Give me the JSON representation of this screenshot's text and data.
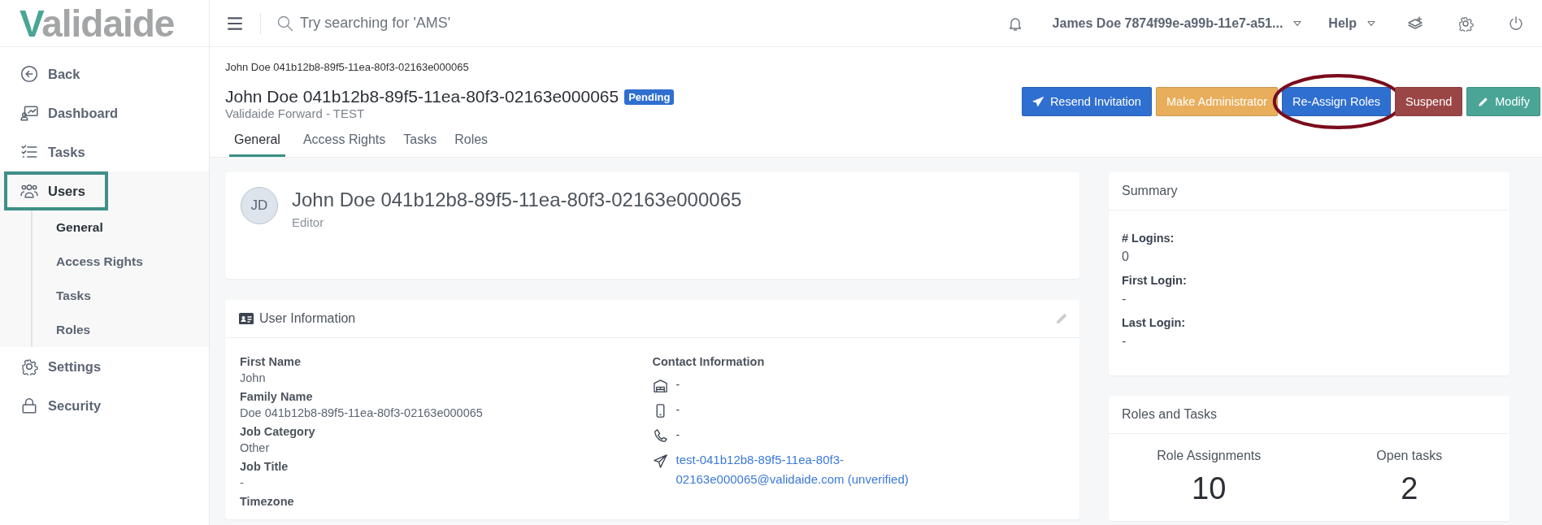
{
  "logo": {
    "text": "Validaide"
  },
  "topbar": {
    "search": {
      "placeholder": "Try searching for 'AMS'"
    },
    "user": "James Doe 7874f99e-a99b-11e7-a51...",
    "help": "Help"
  },
  "sidebar": {
    "items": [
      {
        "label": "Back",
        "kind": "back",
        "selected": false
      },
      {
        "label": "Dashboard",
        "kind": "dashboard",
        "selected": false
      },
      {
        "label": "Tasks",
        "kind": "tasks",
        "selected": false
      },
      {
        "label": "Users",
        "kind": "users",
        "selected": true,
        "expanded": true,
        "children": [
          {
            "label": "General",
            "selected": true
          },
          {
            "label": "Access Rights",
            "selected": false
          },
          {
            "label": "Tasks",
            "selected": false
          },
          {
            "label": "Roles",
            "selected": false
          }
        ]
      },
      {
        "label": "Settings",
        "kind": "settings",
        "selected": false
      },
      {
        "label": "Security",
        "kind": "security",
        "selected": false
      }
    ]
  },
  "page": {
    "breadcrumb": "John Doe 041b12b8-89f5-11ea-80f3-02163e000065",
    "title": "John Doe 041b12b8-89f5-11ea-80f3-02163e000065",
    "status": "Pending",
    "subtitle": "Validaide Forward - TEST",
    "tabs": [
      {
        "label": "General",
        "selected": true
      },
      {
        "label": "Access Rights",
        "selected": false
      },
      {
        "label": "Tasks",
        "selected": false
      },
      {
        "label": "Roles",
        "selected": false
      }
    ],
    "actions": [
      {
        "label": "Resend Invitation",
        "kind": "send",
        "color": "#2f6fd0",
        "circled": false
      },
      {
        "label": "Make Administrator",
        "kind": "plain",
        "color": "#e8ae5c",
        "circled": false
      },
      {
        "label": "Re-Assign Roles",
        "kind": "plain",
        "color": "#2f6fd0",
        "circled": true
      },
      {
        "label": "Suspend",
        "kind": "plain",
        "color": "#9b4646",
        "circled": false
      },
      {
        "label": "Modify",
        "kind": "pencil",
        "color": "#4aa596",
        "circled": false
      }
    ]
  },
  "profile": {
    "initials": "JD",
    "name": "John Doe 041b12b8-89f5-11ea-80f3-02163e000065",
    "role": "Editor"
  },
  "user_information": {
    "title": "User Information",
    "fields": [
      {
        "label": "First Name",
        "value": "John"
      },
      {
        "label": "Family Name",
        "value": "Doe 041b12b8-89f5-11ea-80f3-02163e000065"
      },
      {
        "label": "Job Category",
        "value": "Other"
      },
      {
        "label": "Job Title",
        "value": "-"
      },
      {
        "label": "Timezone"
      }
    ],
    "contact": {
      "title": "Contact Information",
      "items": [
        {
          "kind": "building",
          "text": "-"
        },
        {
          "kind": "mobile",
          "text": "-"
        },
        {
          "kind": "phone",
          "text": "-"
        },
        {
          "kind": "email",
          "text": "test-041b12b8-89f5-11ea-80f3-02163e000065@validaide.com (unverified)"
        }
      ]
    }
  },
  "summary": {
    "title": "Summary",
    "fields": [
      {
        "label": "# Logins:",
        "value": "0"
      },
      {
        "label": "First Login:",
        "value": "-"
      },
      {
        "label": "Last Login:",
        "value": "-"
      }
    ]
  },
  "roles_tasks": {
    "title": "Roles and Tasks",
    "stats": [
      {
        "label": "Role Assignments",
        "value": "10"
      },
      {
        "label": "Open tasks",
        "value": "2"
      }
    ]
  }
}
